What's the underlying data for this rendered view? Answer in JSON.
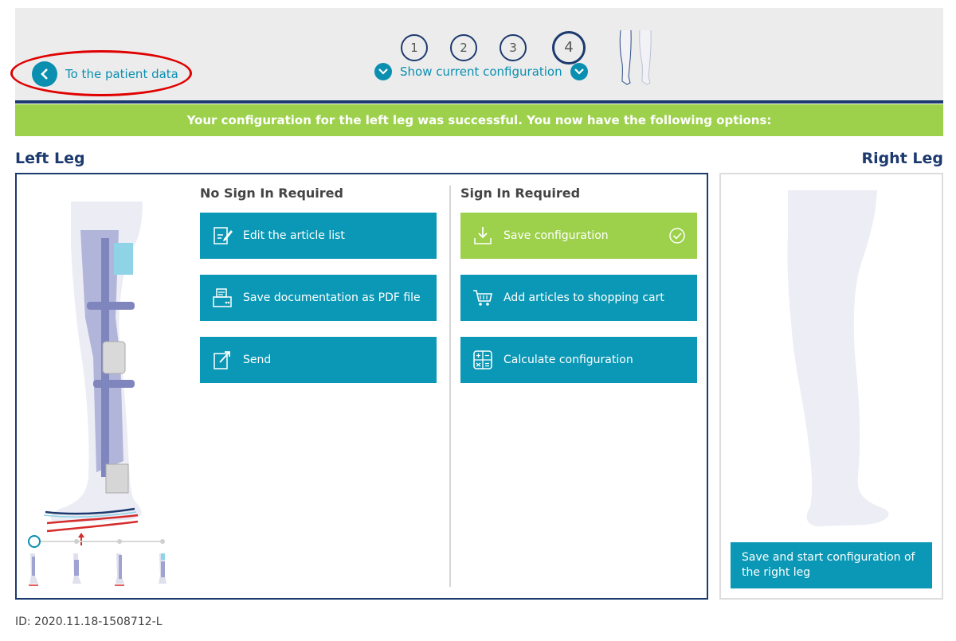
{
  "header": {
    "steps": [
      "1",
      "2",
      "3",
      "4"
    ],
    "active_step": "4",
    "show_config_label": "Show current configuration",
    "back_label": "To the patient data"
  },
  "banner": {
    "text": "Your configuration for the left leg was successful. You now have the following options:"
  },
  "left_leg": {
    "title": "Left Leg",
    "no_sign_in": {
      "heading": "No Sign In Required",
      "buttons": [
        "Edit the article list",
        "Save documentation as PDF file",
        "Send"
      ]
    },
    "sign_in": {
      "heading": "Sign In Required",
      "buttons": [
        "Save configuration",
        "Add articles to shopping cart",
        "Calculate configuration"
      ]
    },
    "slider_position": 0
  },
  "right_leg": {
    "title": "Right Leg",
    "start_button": "Save and start configuration of the right leg"
  },
  "footer": {
    "id_text": "ID: 2020.11.18-1508712-L"
  },
  "colors": {
    "accent": "#0a98b6",
    "navy": "#1d3a6f",
    "success": "#9dd14b",
    "highlight": "#e00000"
  }
}
